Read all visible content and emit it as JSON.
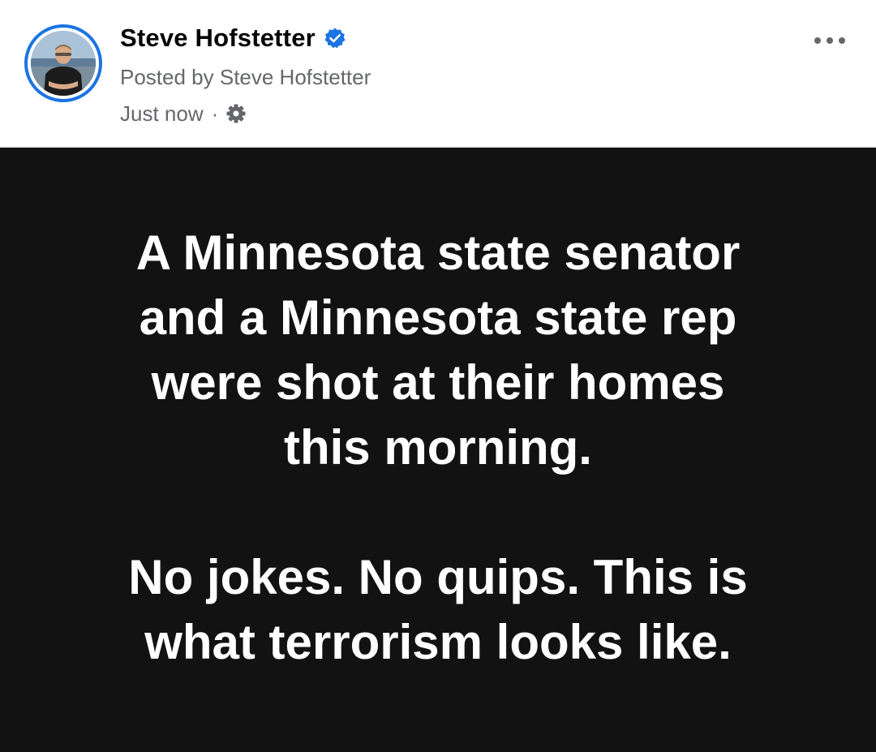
{
  "post": {
    "author": {
      "name": "Steve Hofstetter",
      "verified": true,
      "avatar_icon": "profile-photo"
    },
    "posted_by": "Posted by Steve Hofstetter",
    "timestamp": "Just now",
    "separator": "·",
    "audience_icon": "gear-icon",
    "more_icon": "more-options-icon",
    "body": {
      "paragraphs": [
        {
          "lines": [
            "A Minnesota state senator",
            "and a Minnesota state rep",
            "were shot at their homes",
            "this morning."
          ]
        },
        {
          "lines": [
            "No jokes. No quips. This is",
            "what terrorism looks like."
          ]
        }
      ],
      "background_color": "#121212",
      "text_color": "#ffffff"
    }
  },
  "colors": {
    "brand_blue": "#1b74e4",
    "secondary_text": "#65676b",
    "primary_text": "#050505"
  }
}
